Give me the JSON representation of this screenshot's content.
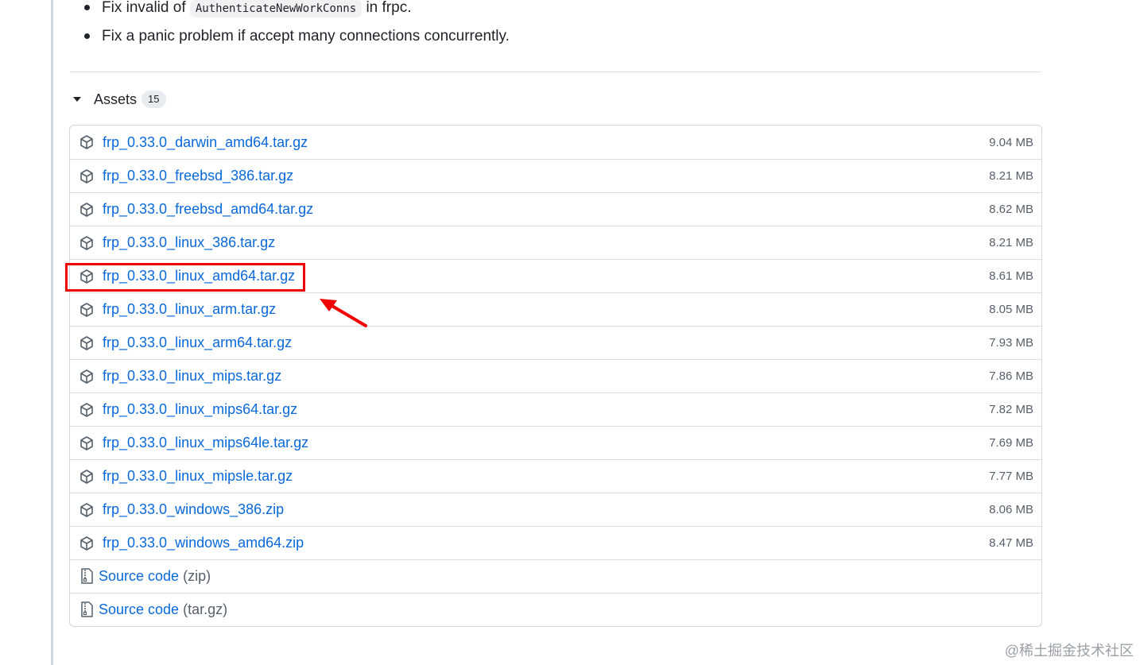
{
  "release_notes": {
    "bullets": [
      {
        "pre": "Fix invalid of ",
        "code": "AuthenticateNewWorkConns",
        "post": " in frpc."
      },
      {
        "text": "Fix a panic problem if accept many connections concurrently."
      }
    ]
  },
  "assets": {
    "title": "Assets",
    "count": "15",
    "files": [
      {
        "name": "frp_0.33.0_darwin_amd64.tar.gz",
        "size": "9.04 MB"
      },
      {
        "name": "frp_0.33.0_freebsd_386.tar.gz",
        "size": "8.21 MB"
      },
      {
        "name": "frp_0.33.0_freebsd_amd64.tar.gz",
        "size": "8.62 MB"
      },
      {
        "name": "frp_0.33.0_linux_386.tar.gz",
        "size": "8.21 MB"
      },
      {
        "name": "frp_0.33.0_linux_amd64.tar.gz",
        "size": "8.61 MB"
      },
      {
        "name": "frp_0.33.0_linux_arm.tar.gz",
        "size": "8.05 MB"
      },
      {
        "name": "frp_0.33.0_linux_arm64.tar.gz",
        "size": "7.93 MB"
      },
      {
        "name": "frp_0.33.0_linux_mips.tar.gz",
        "size": "7.86 MB"
      },
      {
        "name": "frp_0.33.0_linux_mips64.tar.gz",
        "size": "7.82 MB"
      },
      {
        "name": "frp_0.33.0_linux_mips64le.tar.gz",
        "size": "7.69 MB"
      },
      {
        "name": "frp_0.33.0_linux_mipsle.tar.gz",
        "size": "7.77 MB"
      },
      {
        "name": "frp_0.33.0_windows_386.zip",
        "size": "8.06 MB"
      },
      {
        "name": "frp_0.33.0_windows_amd64.zip",
        "size": "8.47 MB"
      }
    ],
    "source": [
      {
        "label": "Source code",
        "ext": "(zip)"
      },
      {
        "label": "Source code",
        "ext": "(tar.gz)"
      }
    ]
  },
  "annotation": {
    "highlight_color": "#f00000"
  },
  "watermark": "@稀土掘金技术社区",
  "colors": {
    "link": "#0969da",
    "muted": "#57606a",
    "border": "#d0d7de"
  }
}
